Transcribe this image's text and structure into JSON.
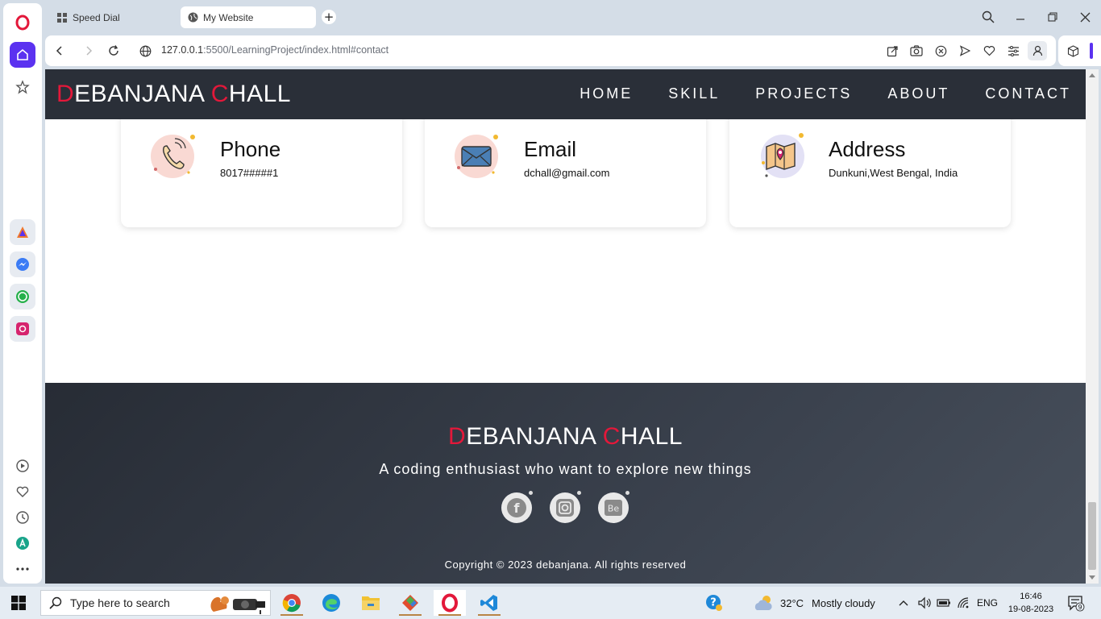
{
  "browser": {
    "tabs": [
      {
        "label": "Speed Dial",
        "icon": "grid-icon"
      },
      {
        "label": "My Website",
        "icon": "globe-icon"
      }
    ],
    "url_host": "127.0.0.1",
    "url_rest": ":5500/LearningProject/index.html#contact"
  },
  "site": {
    "brand_first_initial": "D",
    "brand_first_rest": "EBANJANA ",
    "brand_last_initial": "C",
    "brand_last_rest": "HALL",
    "nav": [
      "HOME",
      "SKILL",
      "PROJECTS",
      "ABOUT",
      "CONTACT"
    ],
    "accent_color": "#e3183a",
    "header_color": "#2a2f38"
  },
  "contact": {
    "cards": [
      {
        "title": "Phone",
        "value": "8017#####1",
        "icon": "phone-icon"
      },
      {
        "title": "Email",
        "value": "dchall@gmail.com",
        "icon": "mail-icon"
      },
      {
        "title": "Address",
        "value": "Dunkuni,West Bengal, India",
        "icon": "map-icon"
      }
    ]
  },
  "footer": {
    "tagline": "A coding enthusiast who want to explore new things",
    "socials": [
      {
        "name": "facebook",
        "glyph": "f"
      },
      {
        "name": "instagram",
        "glyph": ""
      },
      {
        "name": "behance",
        "glyph": "Be"
      }
    ],
    "copyright": "Copyright © 2023 debanjana. All rights reserved"
  },
  "taskbar": {
    "search_placeholder": "Type here to search",
    "weather_temp": "32°C",
    "weather_text": "Mostly cloudy",
    "language": "ENG",
    "time": "16:46",
    "date": "19-08-2023",
    "notification_count": "9"
  }
}
